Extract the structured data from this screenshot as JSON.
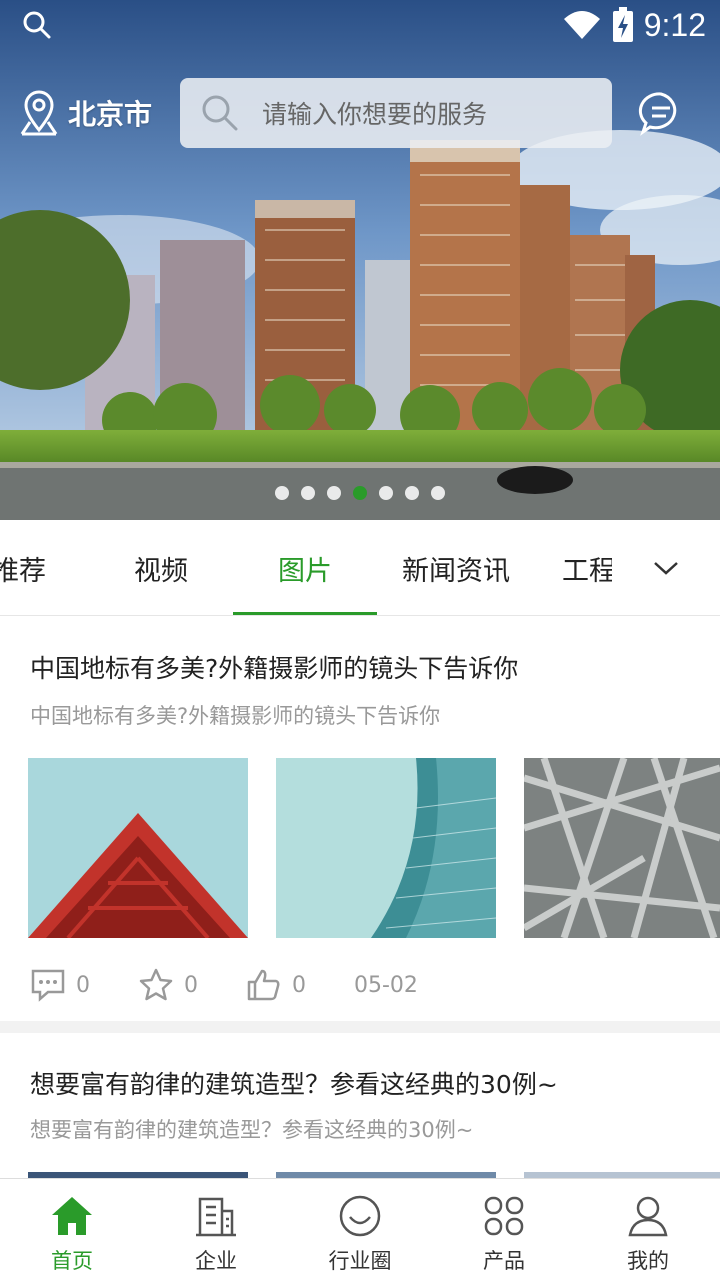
{
  "status_bar": {
    "time": "9:12"
  },
  "header": {
    "location": "北京市",
    "search_placeholder": "请输入你想要的服务"
  },
  "banner": {
    "dot_count": 7,
    "active_dot": 4
  },
  "tabs": {
    "items": [
      "推荐",
      "视频",
      "图片",
      "新闻资讯",
      "工程"
    ],
    "active": "图片"
  },
  "articles": [
    {
      "title": "中国地标有多美?外籍摄影师的镜头下告诉你",
      "subtitle": "中国地标有多美?外籍摄影师的镜头下告诉你",
      "comments": "0",
      "favorites": "0",
      "likes": "0",
      "date": "05-02"
    },
    {
      "title": "想要富有韵律的建筑造型？参看这经典的30例~",
      "subtitle": "想要富有韵律的建筑造型？参看这经典的30例~"
    }
  ],
  "bottom_nav": {
    "items": [
      {
        "label": "首页",
        "icon": "home-icon"
      },
      {
        "label": "企业",
        "icon": "building-icon"
      },
      {
        "label": "行业圈",
        "icon": "smile-circle-icon"
      },
      {
        "label": "产品",
        "icon": "grid-icon"
      },
      {
        "label": "我的",
        "icon": "user-icon"
      }
    ],
    "active": "首页"
  },
  "colors": {
    "accent": "#2a9b2a",
    "text": "#222222",
    "muted": "#999999"
  }
}
